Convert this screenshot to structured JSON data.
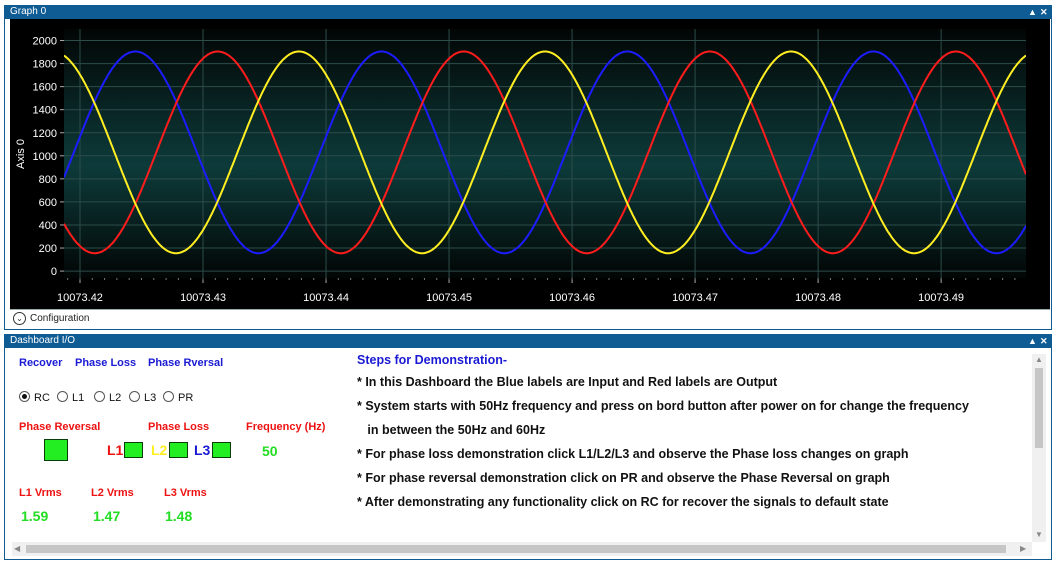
{
  "graph_panel": {
    "title": "Graph 0",
    "controls": [
      "▲",
      "✕"
    ]
  },
  "chart_data": {
    "type": "line",
    "ylabel": "Axis 0",
    "ylim": [
      -60,
      2100
    ],
    "xlim": [
      10073.4187,
      10073.4969
    ],
    "y_ticks": [
      "2000",
      "1800",
      "1600",
      "1400",
      "1200",
      "1000",
      "800",
      "600",
      "400",
      "200",
      "0"
    ],
    "x_ticks": [
      "10073.42",
      "10073.43",
      "10073.44",
      "10073.45",
      "10073.46",
      "10073.47",
      "10073.48",
      "10073.49"
    ],
    "grid": true,
    "series": [
      {
        "color": "#1c1cff",
        "amplitude": 875,
        "offset": 1030,
        "period": 0.02,
        "peak_x": 10073.4245
      },
      {
        "color": "#ff1c1c",
        "amplitude": 875,
        "offset": 1030,
        "period": 0.02,
        "peak_x": 10073.4312
      },
      {
        "color": "#ffee22",
        "amplitude": 875,
        "offset": 1030,
        "period": 0.02,
        "peak_x": 10073.4378
      }
    ]
  },
  "config_bar": {
    "icon": "chevron-down-icon",
    "label": "Configuration"
  },
  "dashboard_panel": {
    "title": "Dashboard I/O",
    "controls": [
      "▲",
      "✕"
    ]
  },
  "controls": {
    "recover": "Recover",
    "phase_loss": "Phase Loss",
    "phase_reversal_input": "Phase Rversal",
    "radios": [
      {
        "label": "RC",
        "checked": true
      },
      {
        "label": "L1",
        "checked": false
      },
      {
        "label": "L2",
        "checked": false
      },
      {
        "label": "L3",
        "checked": false
      },
      {
        "label": "PR",
        "checked": false
      }
    ]
  },
  "outputs": {
    "phase_reversal": "Phase Reversal",
    "phase_loss": "Phase Loss",
    "frequency_label": "Frequency (Hz)",
    "frequency_value": "50",
    "l1": "L1",
    "l2": "L2",
    "l3": "L3",
    "l1_color": "#ee1111",
    "l2_color": "#ffee22",
    "l3_color": "#1a1ad4",
    "led_color": "#22ee22"
  },
  "vrms": {
    "l1_label": "L1 Vrms",
    "l2_label": "L2 Vrms",
    "l3_label": "L3 Vrms",
    "l1_value": "1.59",
    "l2_value": "1.47",
    "l3_value": "1.48"
  },
  "steps": {
    "title": "Steps for Demonstration-",
    "lines": [
      "* In this Dashboard the  Blue labels  are Input and  Red labels  are Output",
      "* System starts with 50Hz frequency and press on bord button after power on for change the frequency",
      "   in between the 50Hz and 60Hz",
      "* For phase loss demonstration click L1/L2/L3 and observe the Phase loss changes on graph",
      "* For phase reversal demonstration click on PR and observe the Phase Reversal on graph",
      "* After demonstrating any functionality click on RC for recover the signals to default state"
    ]
  }
}
